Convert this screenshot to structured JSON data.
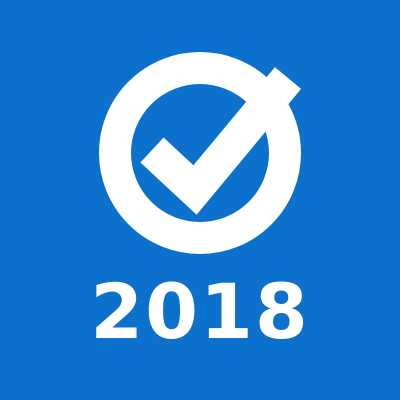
{
  "icon": {
    "year": "2018",
    "background_color": "#0C71CC",
    "foreground_color": "#FFFFFF",
    "mark": "check-circle-icon"
  }
}
